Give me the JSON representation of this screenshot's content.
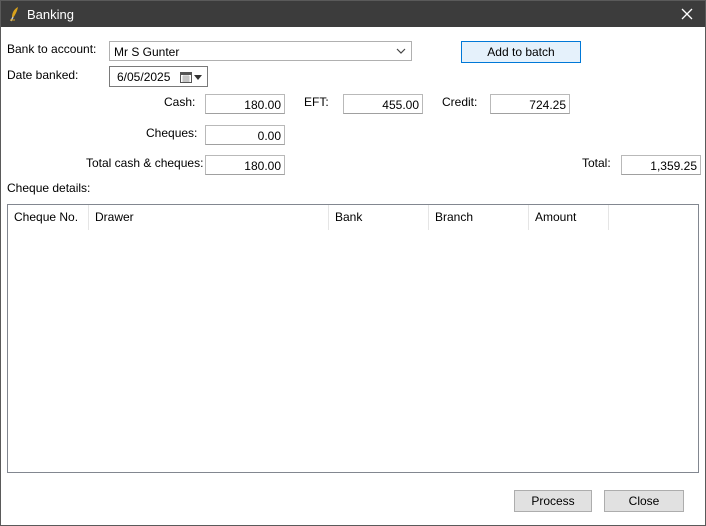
{
  "window": {
    "title": "Banking"
  },
  "icons": {
    "app": "quill-pen-icon",
    "close": "close-icon",
    "dropdown": "chevron-down-icon",
    "calendar": "calendar-icon"
  },
  "form": {
    "bank_to_account_label": "Bank to account:",
    "bank_to_account_value": "Mr S Gunter",
    "date_banked_label": "Date banked:",
    "date_banked_value": "6/05/2025",
    "add_to_batch_label": "Add to batch",
    "cash_label": "Cash:",
    "cash_value": "180.00",
    "eft_label": "EFT:",
    "eft_value": "455.00",
    "credit_label": "Credit:",
    "credit_value": "724.25",
    "cheques_label": "Cheques:",
    "cheques_value": "0.00",
    "total_cash_cheques_label": "Total cash & cheques:",
    "total_cash_cheques_value": "180.00",
    "total_label": "Total:",
    "total_value": "1,359.25",
    "cheque_details_label": "Cheque details:"
  },
  "cheque_table": {
    "columns": [
      "Cheque No.",
      "Drawer",
      "Bank",
      "Branch",
      "Amount"
    ],
    "rows": []
  },
  "footer": {
    "process_label": "Process",
    "close_label": "Close"
  }
}
